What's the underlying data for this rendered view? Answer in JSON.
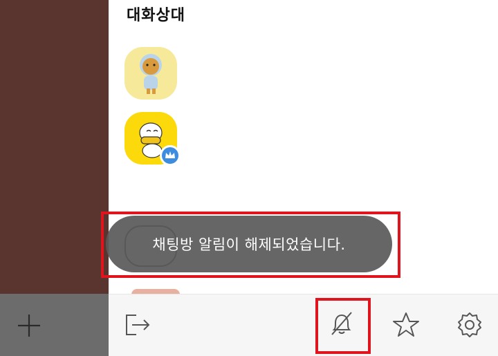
{
  "chat_settings": {
    "section_title": "대화상대",
    "members": [
      {
        "name": "ryan-avatar",
        "badge": null
      },
      {
        "name": "muzi-avatar",
        "badge": "crown-icon"
      }
    ]
  },
  "toast": {
    "message": "채팅방 알림이 해제되었습니다."
  },
  "bottom_bar": {
    "icons": [
      "plus-icon",
      "exit-icon",
      "bell-off-icon",
      "star-icon",
      "gear-icon"
    ]
  },
  "colors": {
    "left_panel": "#5a3530",
    "highlight": "#e0141c",
    "toast_bg": "#5a5a5a",
    "badge_blue": "#3e8ce0"
  }
}
